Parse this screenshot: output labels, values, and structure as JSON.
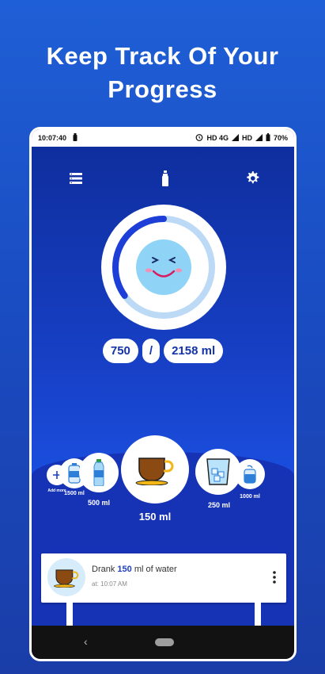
{
  "headline": {
    "line1": "Keep Track Of Your",
    "line2": "Progress"
  },
  "status_bar": {
    "time": "10:07:40",
    "network": "HD 4G",
    "hd": "HD",
    "battery": "70%"
  },
  "progress": {
    "current": "750",
    "separator": "/",
    "target": "2158 ml",
    "fraction": 0.35
  },
  "cups": {
    "add_more": "Add more",
    "c1500_bottle": "1500 ml",
    "c500": "500 ml",
    "selected": "150 ml",
    "c250": "250 ml",
    "c1000": "1000 ml"
  },
  "history": {
    "prefix": "Drank",
    "amount": "150",
    "suffix": "ml of water",
    "time": "at: 10:07 AM"
  },
  "colors": {
    "accent": "#1c3fc4",
    "ring_progress": "#1d3fd8",
    "ring_track": "#bcd9f6",
    "face": "#8fd3f7"
  },
  "icons": {
    "menu": "list-icon",
    "bottle": "bottle-icon",
    "settings": "gear-icon",
    "more": "more-vert-icon"
  }
}
